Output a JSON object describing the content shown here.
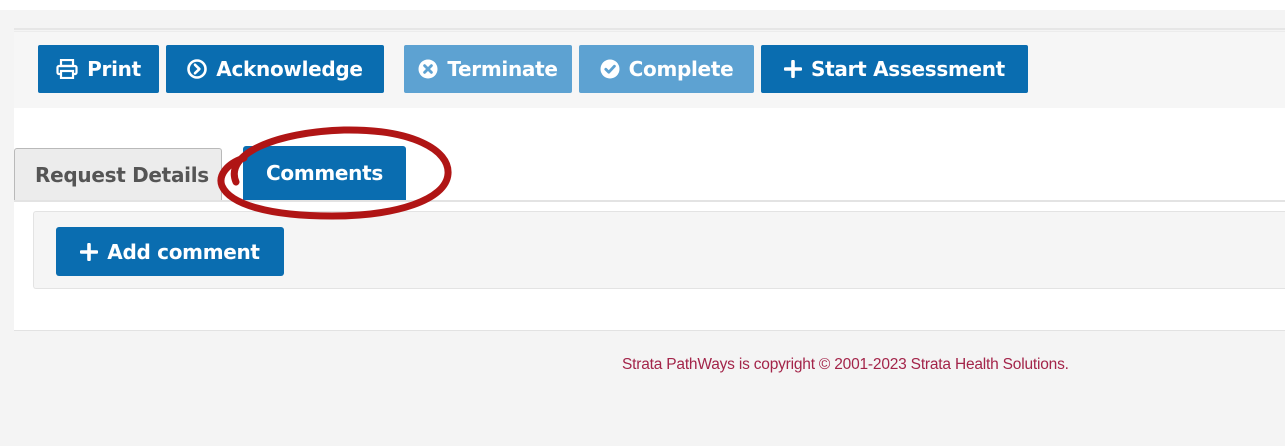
{
  "toolbar": {
    "print_label": "Print",
    "acknowledge_label": "Acknowledge",
    "terminate_label": "Terminate",
    "complete_label": "Complete",
    "start_assessment_label": "Start Assessment"
  },
  "tabs": [
    {
      "label": "Request Details",
      "active": false
    },
    {
      "label": "Comments",
      "active": true
    }
  ],
  "comments": {
    "add_comment_label": "Add comment"
  },
  "footer": {
    "copyright": "Strata PathWays is copyright © 2001-2023 Strata Health Solutions."
  },
  "icons": {
    "print": "print-icon",
    "acknowledge": "circle-arrow-right-icon",
    "terminate": "circle-x-icon",
    "complete": "circle-check-icon",
    "start_assessment": "plus-icon",
    "add_comment": "plus-icon"
  },
  "colors": {
    "primary_button": "#0a6db0",
    "disabled_button": "#5da2d2",
    "annotation_ring": "#b01515",
    "footer_text": "#a32449"
  }
}
